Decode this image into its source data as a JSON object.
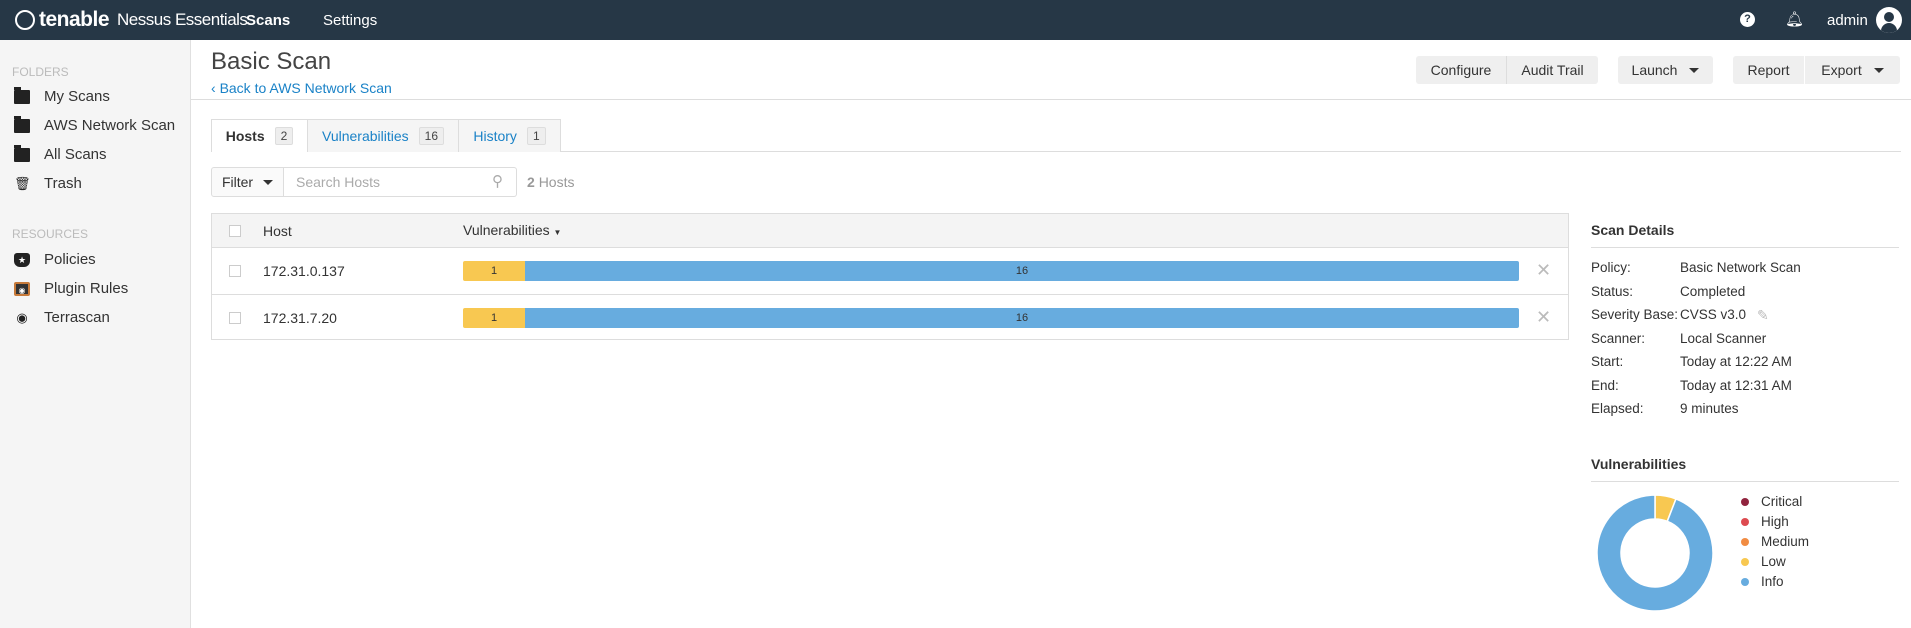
{
  "topbar": {
    "brand": "tenable",
    "product": "Nessus Essentials",
    "nav": [
      "Scans",
      "Settings"
    ],
    "user": "admin"
  },
  "sidebar": {
    "folders_label": "FOLDERS",
    "folders": [
      "My Scans",
      "AWS Network Scan",
      "All Scans",
      "Trash"
    ],
    "resources_label": "RESOURCES",
    "resources": [
      "Policies",
      "Plugin Rules",
      "Terrascan"
    ]
  },
  "header": {
    "title": "Basic Scan",
    "back": "Back to AWS Network Scan",
    "buttons": {
      "configure": "Configure",
      "audit": "Audit Trail",
      "launch": "Launch",
      "report": "Report",
      "export": "Export"
    }
  },
  "tabs": [
    {
      "label": "Hosts",
      "count": "2"
    },
    {
      "label": "Vulnerabilities",
      "count": "16"
    },
    {
      "label": "History",
      "count": "1"
    }
  ],
  "filter": {
    "label": "Filter",
    "placeholder": "Search Hosts",
    "count": "2",
    "count_label": "Hosts"
  },
  "table": {
    "columns": [
      "Host",
      "Vulnerabilities"
    ],
    "rows": [
      {
        "host": "172.31.0.137",
        "low": 1,
        "info": 16,
        "low_label": "1",
        "info_label": "16"
      },
      {
        "host": "172.31.7.20",
        "low": 1,
        "info": 16,
        "low_label": "1",
        "info_label": "16"
      }
    ]
  },
  "details": {
    "title": "Scan Details",
    "items": [
      [
        "Policy:",
        "Basic Network Scan"
      ],
      [
        "Status:",
        "Completed"
      ],
      [
        "Severity Base:",
        "CVSS v3.0"
      ],
      [
        "Scanner:",
        "Local Scanner"
      ],
      [
        "Start:",
        "Today at 12:22 AM"
      ],
      [
        "End:",
        "Today at 12:31 AM"
      ],
      [
        "Elapsed:",
        "9 minutes"
      ]
    ]
  },
  "vulns": {
    "title": "Vulnerabilities",
    "legend": [
      {
        "label": "Critical",
        "color": "#91243e"
      },
      {
        "label": "High",
        "color": "#dd4b50"
      },
      {
        "label": "Medium",
        "color": "#f18c43"
      },
      {
        "label": "Low",
        "color": "#f8c851"
      },
      {
        "label": "Info",
        "color": "#67acdf"
      }
    ]
  },
  "chart_data": {
    "type": "pie",
    "donut": true,
    "categories": [
      "Critical",
      "High",
      "Medium",
      "Low",
      "Info"
    ],
    "values": [
      0,
      0,
      0,
      1,
      16
    ],
    "colors": [
      "#91243e",
      "#dd4b50",
      "#f18c43",
      "#f8c851",
      "#67acdf"
    ]
  }
}
